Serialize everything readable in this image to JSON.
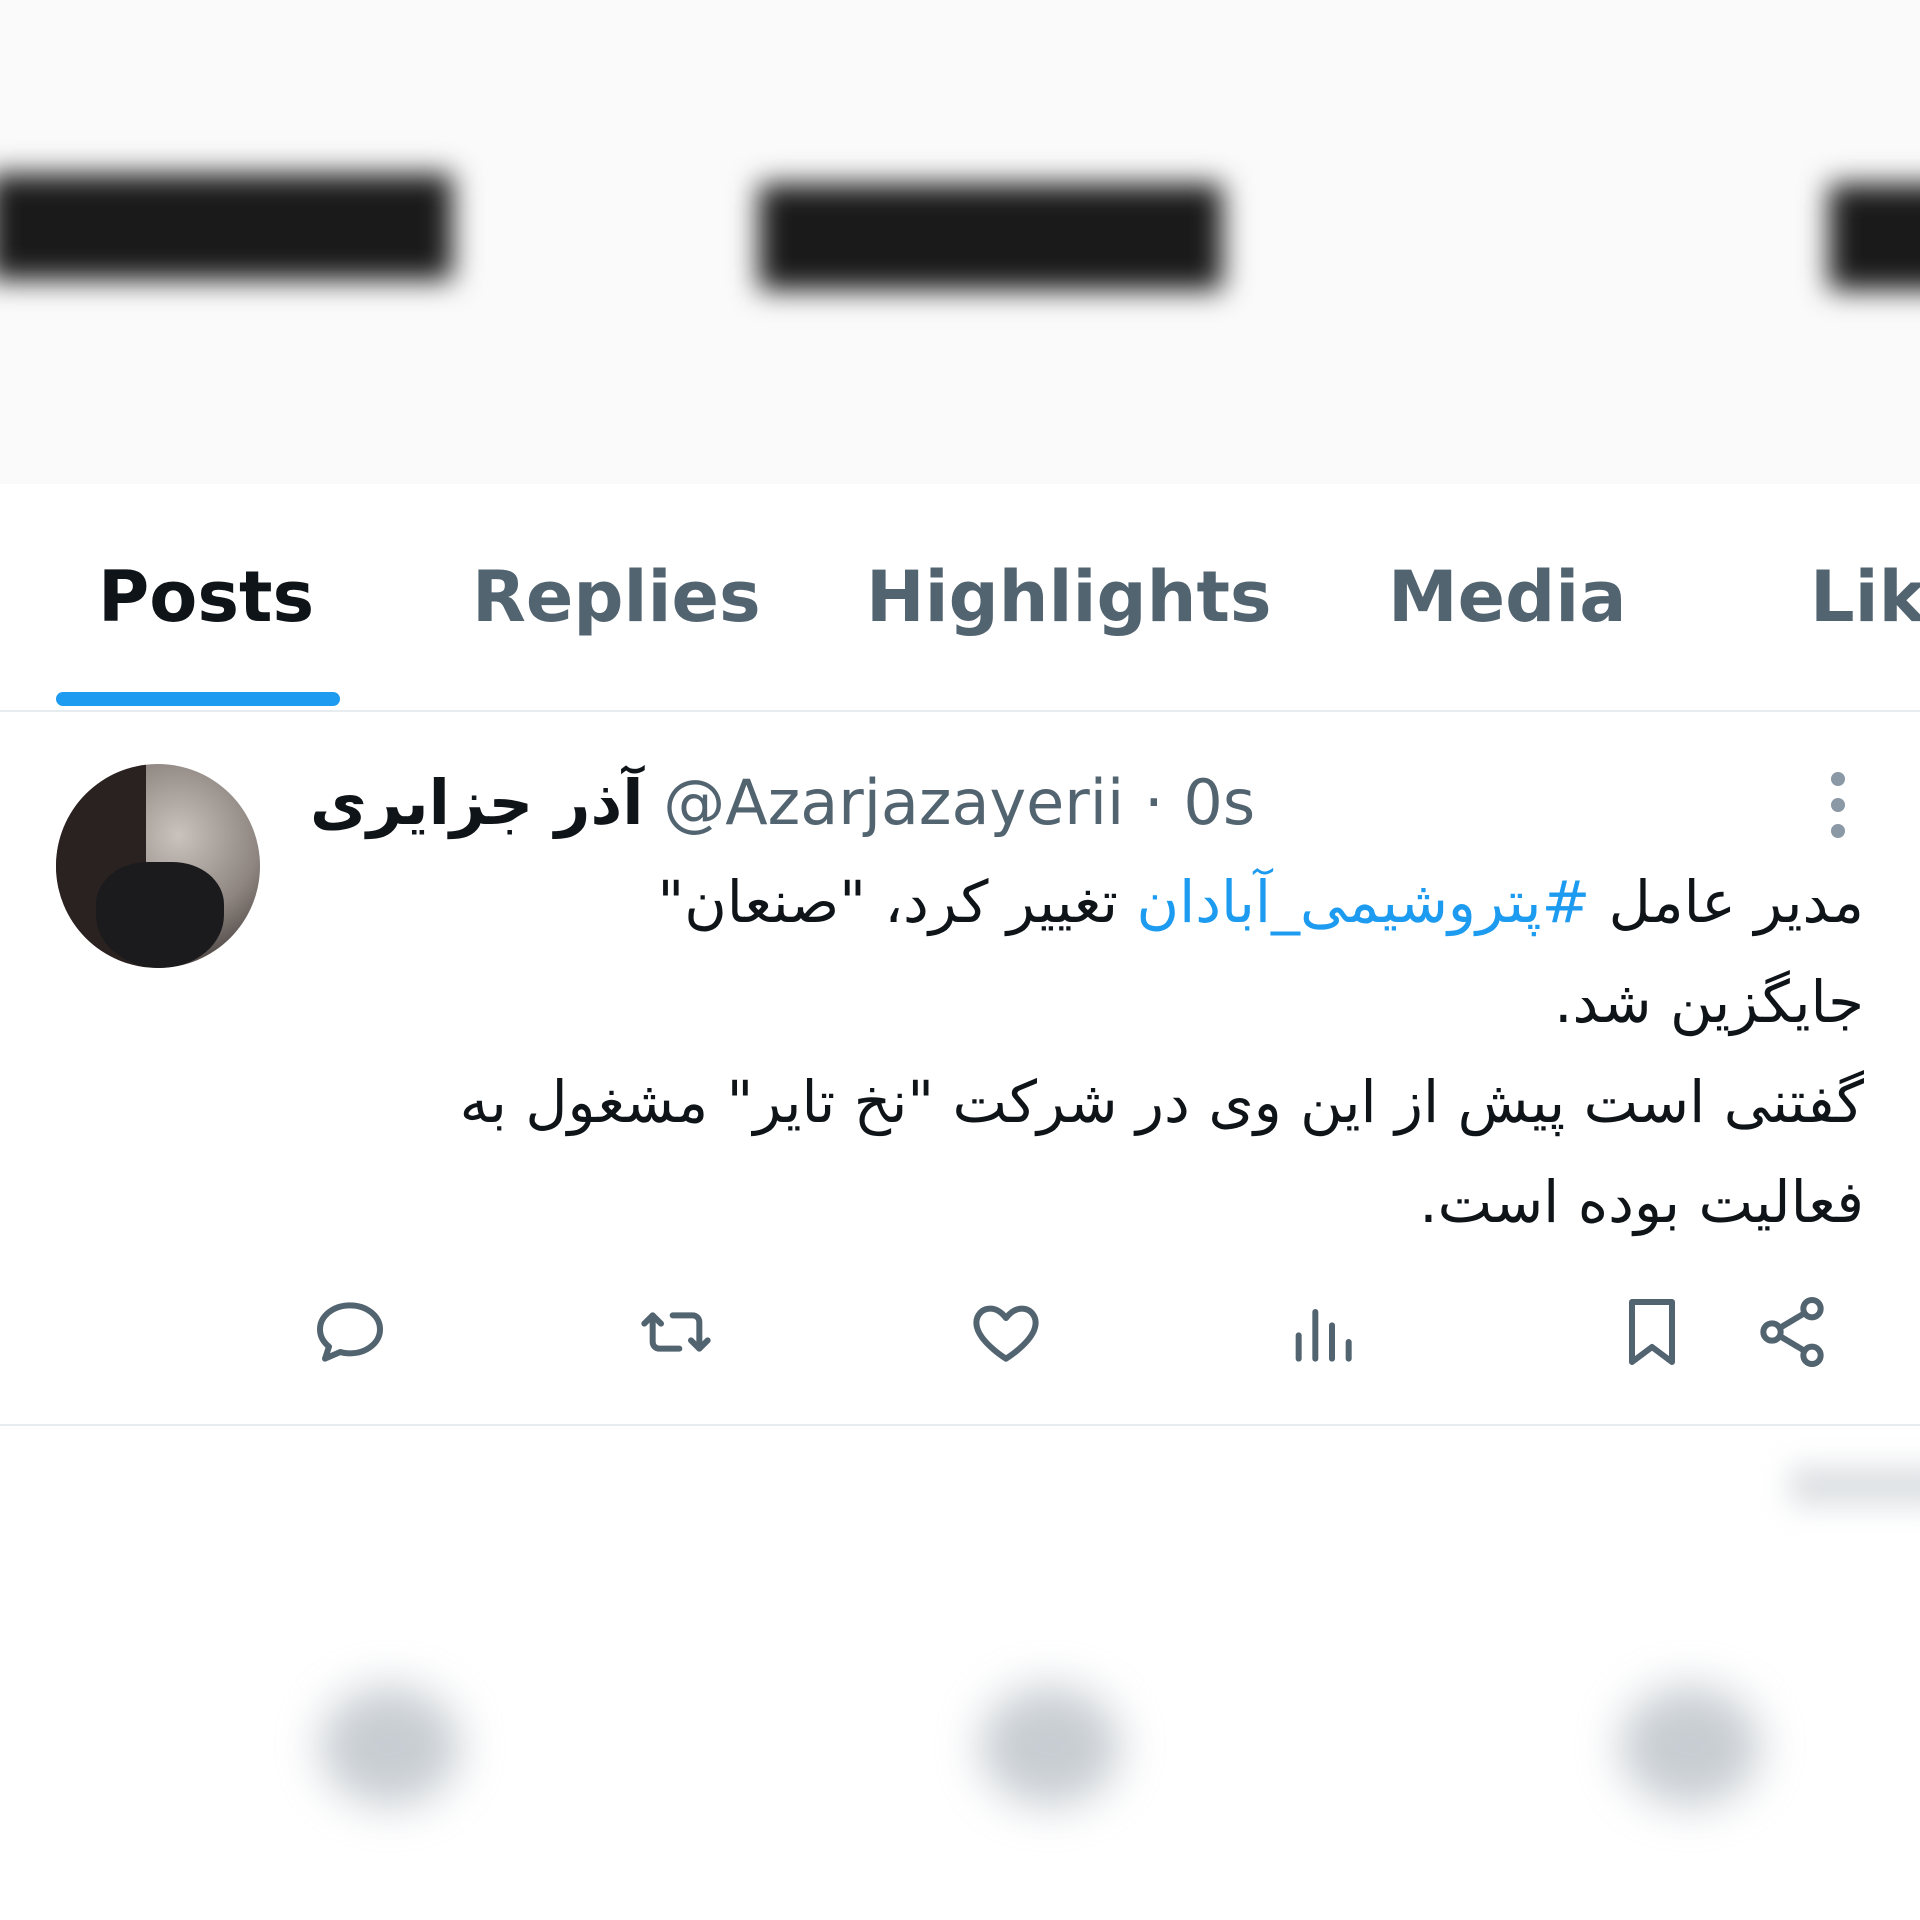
{
  "tabs": [
    {
      "label": "Posts",
      "active": true
    },
    {
      "label": "Replies",
      "active": false
    },
    {
      "label": "Highlights",
      "active": false
    },
    {
      "label": "Media",
      "active": false
    },
    {
      "label": "Lik",
      "active": false
    }
  ],
  "post": {
    "display_name": "آذر جزایری",
    "handle": "@Azarjazayerii",
    "separator": "·",
    "time": "0s",
    "text_line1_before": "مدیر عامل ",
    "hashtag": "#پتروشیمی_آبادان",
    "text_line1_after": " تغییر کرد،  \"صنعان\"",
    "text_line2": "جایگزین شد.",
    "text_line3": "گفتنی است پیش از این وی در شرکت \"نخ تایر\" مشغول به",
    "text_line4": "فعالیت بوده است."
  },
  "icons": {
    "reply": "reply-icon",
    "repost": "repost-icon",
    "like": "heart-icon",
    "views": "views-icon",
    "bookmark": "bookmark-icon",
    "share": "share-icon",
    "more": "more-vertical-icon"
  },
  "colors": {
    "accent": "#1d9bf0",
    "muted": "#536471",
    "text": "#0f1419"
  }
}
